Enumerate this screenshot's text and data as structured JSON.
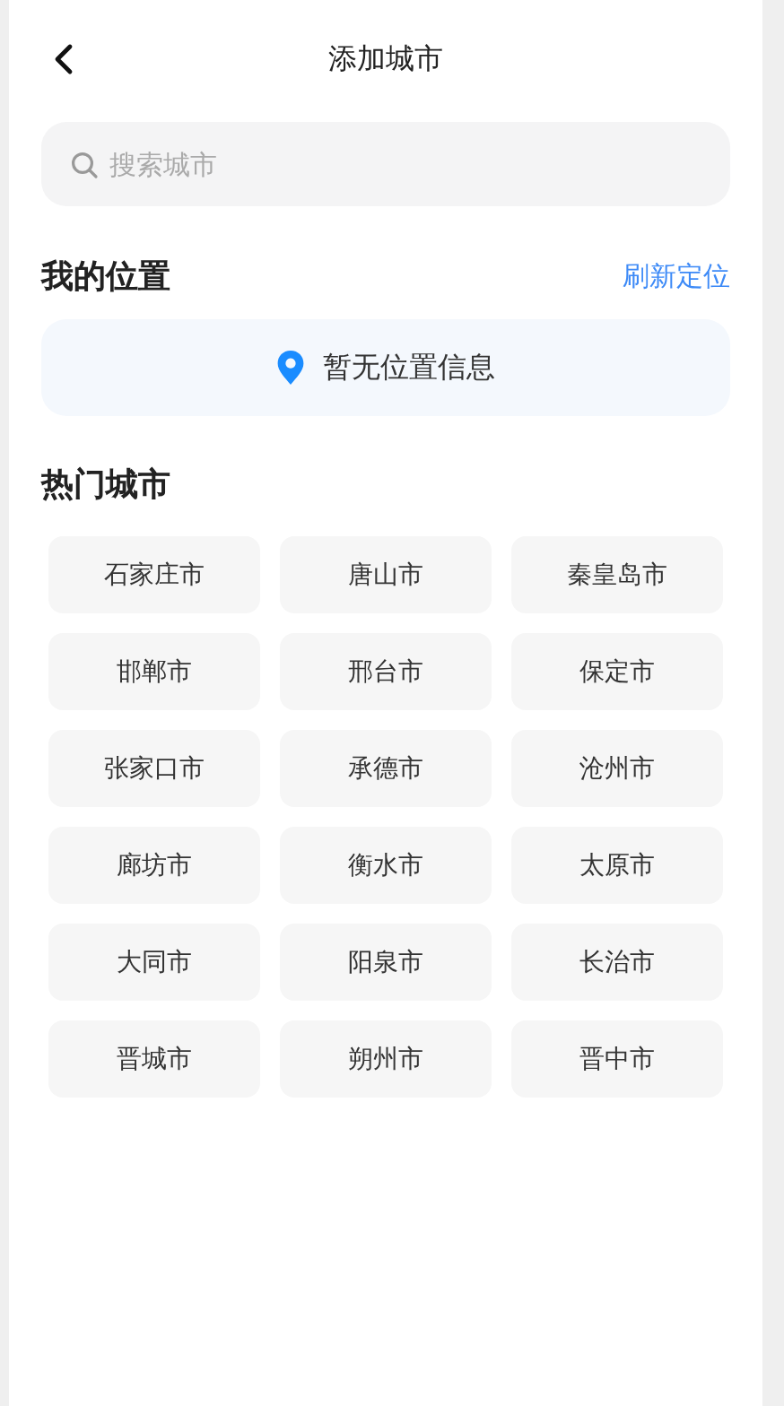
{
  "header": {
    "title": "添加城市"
  },
  "search": {
    "placeholder": "搜索城市"
  },
  "my_location": {
    "title": "我的位置",
    "refresh_link": "刷新定位",
    "status": "暂无位置信息"
  },
  "hot_cities": {
    "title": "热门城市",
    "cities": [
      "石家庄市",
      "唐山市",
      "秦皇岛市",
      "邯郸市",
      "邢台市",
      "保定市",
      "张家口市",
      "承德市",
      "沧州市",
      "廊坊市",
      "衡水市",
      "太原市",
      "大同市",
      "阳泉市",
      "长治市",
      "晋城市",
      "朔州市",
      "晋中市"
    ]
  }
}
